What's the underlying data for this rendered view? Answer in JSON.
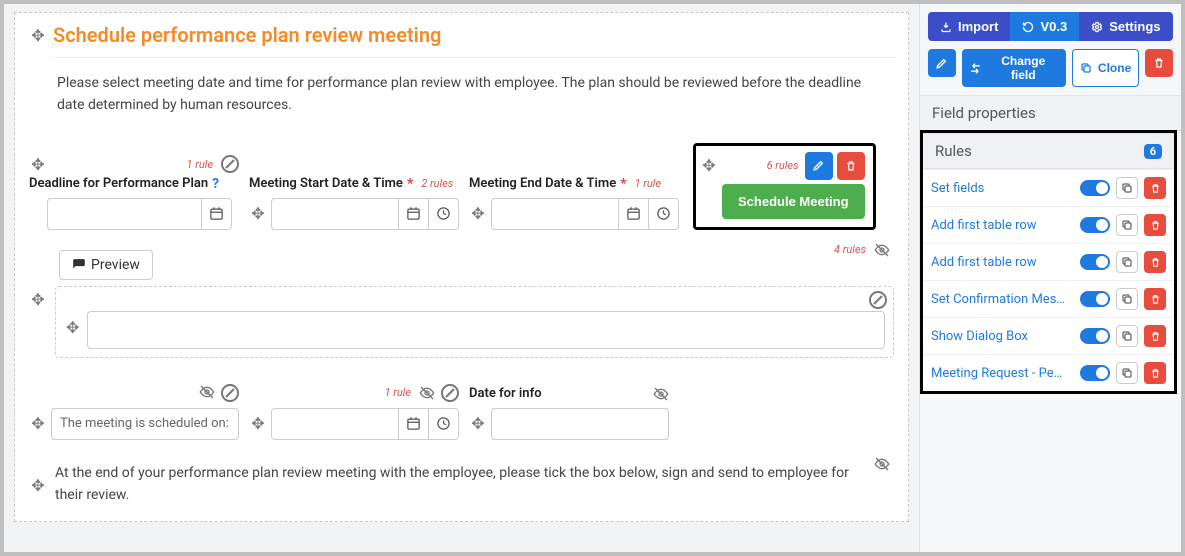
{
  "toolbar": {
    "import": "Import",
    "version": "V0.3",
    "settings": "Settings",
    "change_field": "Change field",
    "clone": "Clone"
  },
  "panels": {
    "field_properties": "Field properties",
    "rules": "Rules",
    "rules_count": "6"
  },
  "form": {
    "title": "Schedule performance plan review meeting",
    "description": "Please select meeting date and time for performance plan review with employee. The plan should be reviewed before the deadline date determined by human resources.",
    "fields": {
      "deadline_label": "Deadline for Performance Plan",
      "deadline_rules": "1 rule",
      "start_label": "Meeting Start Date & Time",
      "start_rules": "2 rules",
      "end_label": "Meeting End Date & Time",
      "end_rules": "1 rule",
      "schedule_rules": "6 rules",
      "schedule_button": "Schedule Meeting",
      "preview": "Preview",
      "preview_rules": "4 rules",
      "meeting_text": "The meeting is scheduled on:",
      "meeting_text_rules": "1 rule",
      "date_for_info": "Date for info",
      "note": "At the end of your performance plan review meeting with the employee, please tick the box below, sign and send to employee for their review."
    }
  },
  "rules": [
    {
      "name": "Set fields"
    },
    {
      "name": "Add first table row"
    },
    {
      "name": "Add first table row"
    },
    {
      "name": "Set Confirmation Mes…"
    },
    {
      "name": "Show Dialog Box"
    },
    {
      "name": "Meeting Request - Pe…"
    }
  ]
}
